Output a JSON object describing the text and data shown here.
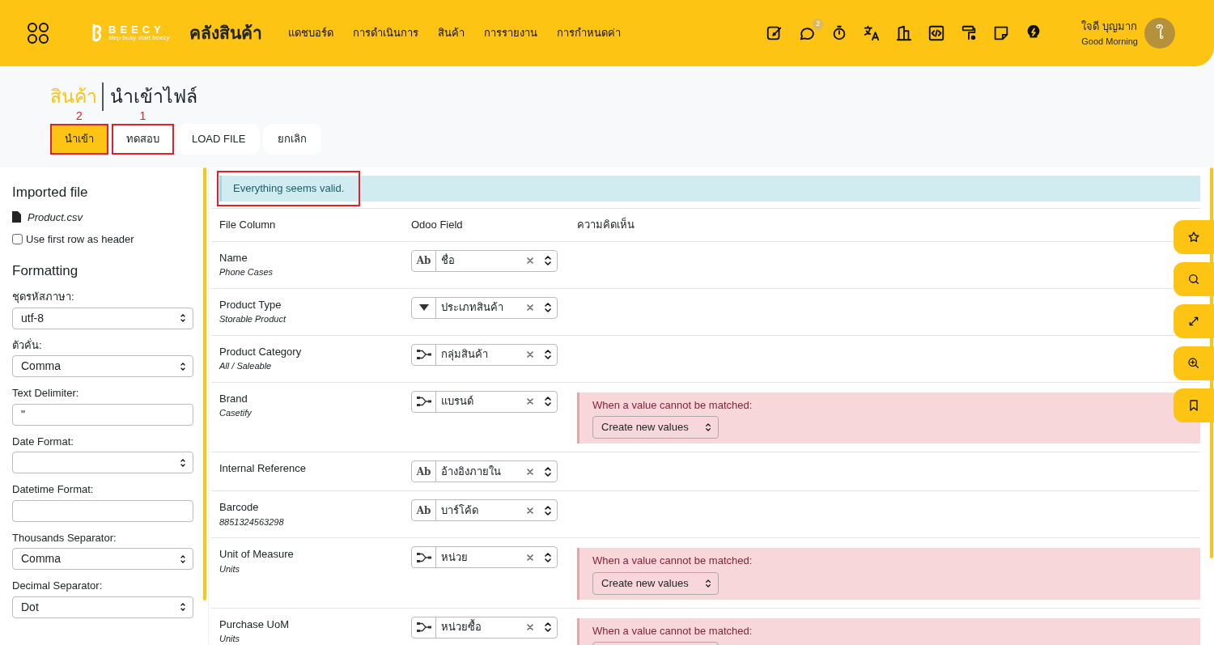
{
  "header": {
    "logo": {
      "name": "BEECY",
      "tagline": "step busy start beecy"
    },
    "app_title": "คลังสินค้า",
    "menu": [
      "แดชบอร์ด",
      "การดำเนินการ",
      "สินค้า",
      "การรายงาน",
      "การกำหนดค่า"
    ],
    "icons": [
      {
        "kind": "edit"
      },
      {
        "kind": "chat",
        "badge": "2"
      },
      {
        "kind": "timer"
      },
      {
        "kind": "translate"
      },
      {
        "kind": "building"
      },
      {
        "kind": "code"
      },
      {
        "kind": "paint"
      },
      {
        "kind": "note"
      },
      {
        "kind": "bulb"
      }
    ],
    "user": {
      "name": "ใจดี บุญมาก",
      "greeting": "Good Morning",
      "initial": "ใ"
    }
  },
  "breadcrumb": {
    "parent": "สินค้า",
    "current": "นำเข้าไฟล์"
  },
  "buttons": [
    {
      "label": "นำเข้า",
      "kind": "primary",
      "annotation": "2"
    },
    {
      "label": "ทดสอบ",
      "kind": "secondary",
      "annotation": "1"
    },
    {
      "label": "LOAD FILE",
      "kind": "secondary"
    },
    {
      "label": "ยกเลิก",
      "kind": "secondary"
    }
  ],
  "sidebar": {
    "imported_title": "Imported file",
    "file_name": "Product.csv",
    "header_option": {
      "label": "Use first row as header",
      "checked": false
    },
    "formatting_title": "Formatting",
    "fields": [
      {
        "label": "ชุดรหัสภาษา:",
        "kind": "select",
        "value": "utf-8"
      },
      {
        "label": "ตัวคั่น:",
        "kind": "select",
        "value": "Comma"
      },
      {
        "label": "Text Delimiter:",
        "kind": "input",
        "value": "\""
      },
      {
        "label": "Date Format:",
        "kind": "select"
      },
      {
        "label": "Datetime Format:",
        "kind": "input"
      },
      {
        "label": "Thousands Separator:",
        "kind": "select",
        "value": "Comma"
      },
      {
        "label": "Decimal Separator:",
        "kind": "select",
        "value": "Dot"
      }
    ]
  },
  "alert": {
    "text": "Everything seems valid.",
    "annotated": true
  },
  "columns": [
    "File Column",
    "Odoo Field",
    "ความคิดเห็น"
  ],
  "rows": [
    {
      "name": "Name",
      "sample": "Phone Cases",
      "kind": "text",
      "icon_text": "Ab",
      "field": "ชื่อ"
    },
    {
      "name": "Product Type",
      "sample": "Storable Product",
      "kind": "selection",
      "field": "ประเภทสินค้า"
    },
    {
      "name": "Product Category",
      "sample": "All / Saleable",
      "kind": "relation",
      "field": "กลุ่มสินค้า"
    },
    {
      "name": "Brand",
      "sample": "Casetify",
      "kind": "relation",
      "field": "แบรนด์",
      "comment": {
        "label": "When a value cannot be matched:",
        "value": "Create new values"
      }
    },
    {
      "name": "Internal Reference",
      "kind": "text",
      "icon_text": "Ab",
      "field": "อ้างอิงภายใน"
    },
    {
      "name": "Barcode",
      "sample": "8851324563298",
      "kind": "text",
      "icon_text": "Ab",
      "field": "บาร์โค้ด"
    },
    {
      "name": "Unit of Measure",
      "sample": "Units",
      "kind": "relation",
      "field": "หน่วย",
      "comment": {
        "label": "When a value cannot be matched:",
        "value": "Create new values"
      }
    },
    {
      "name": "Purchase UoM",
      "sample": "Units",
      "kind": "relation",
      "field": "หน่วยซื้อ",
      "comment": {
        "label": "When a value cannot be matched:"
      }
    }
  ],
  "side_tools": [
    {
      "kind": "star"
    },
    {
      "kind": "search"
    },
    {
      "kind": "expand"
    },
    {
      "kind": "zoom-in"
    },
    {
      "kind": "bookmark"
    }
  ]
}
